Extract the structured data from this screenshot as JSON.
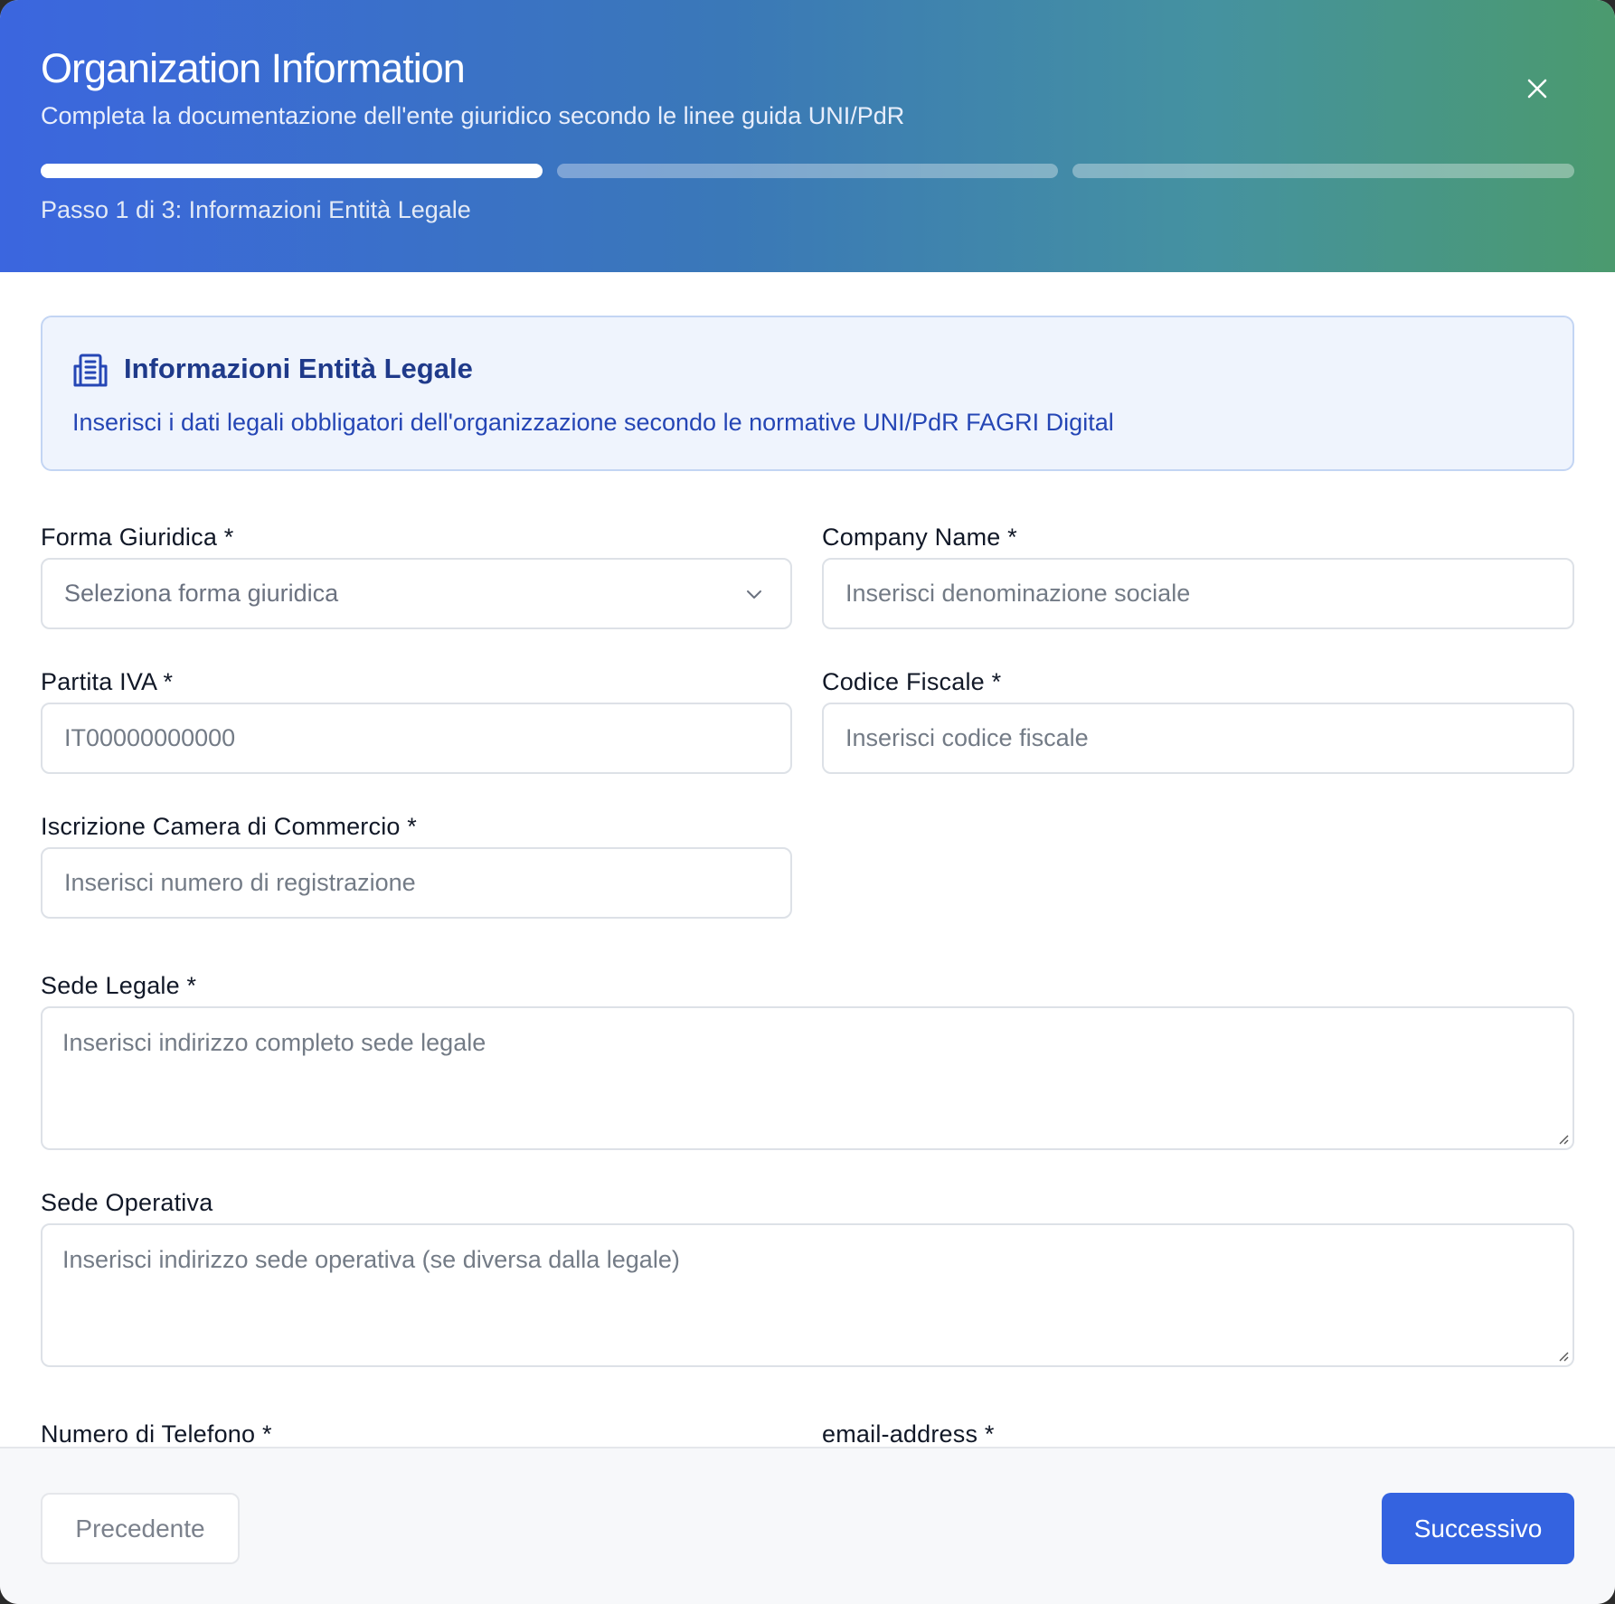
{
  "header": {
    "title": "Organization Information",
    "subtitle": "Completa la documentazione dell'ente giuridico secondo le linee guida UNI/PdR",
    "step_text": "Passo 1 di 3: Informazioni Entità Legale",
    "progress": {
      "current_step": 1,
      "total_steps": 3
    }
  },
  "info_box": {
    "icon": "building-icon",
    "title": "Informazioni Entità Legale",
    "description": "Inserisci i dati legali obbligatori dell'organizzazione secondo le normative UNI/PdR FAGRI Digital"
  },
  "form": {
    "forma_giuridica": {
      "label": "Forma Giuridica *",
      "placeholder": "Seleziona forma giuridica"
    },
    "company_name": {
      "label": "Company Name *",
      "placeholder": "Inserisci denominazione sociale"
    },
    "partita_iva": {
      "label": "Partita IVA *",
      "placeholder": "IT00000000000"
    },
    "codice_fiscale": {
      "label": "Codice Fiscale *",
      "placeholder": "Inserisci codice fiscale"
    },
    "camera_commercio": {
      "label": "Iscrizione Camera di Commercio *",
      "placeholder": "Inserisci numero di registrazione"
    },
    "sede_legale": {
      "label": "Sede Legale *",
      "placeholder": "Inserisci indirizzo completo sede legale"
    },
    "sede_operativa": {
      "label": "Sede Operativa",
      "placeholder": "Inserisci indirizzo sede operativa (se diversa dalla legale)"
    },
    "telefono": {
      "label": "Numero di Telefono *"
    },
    "email": {
      "label": "email-address *"
    }
  },
  "footer": {
    "prev_label": "Precedente",
    "next_label": "Successivo"
  },
  "colors": {
    "primary": "#3463e0",
    "header_gradient_start": "#3b66df",
    "header_gradient_end": "#4b9a6e",
    "info_bg": "#eff4fd",
    "info_title": "#1f3a8a"
  }
}
